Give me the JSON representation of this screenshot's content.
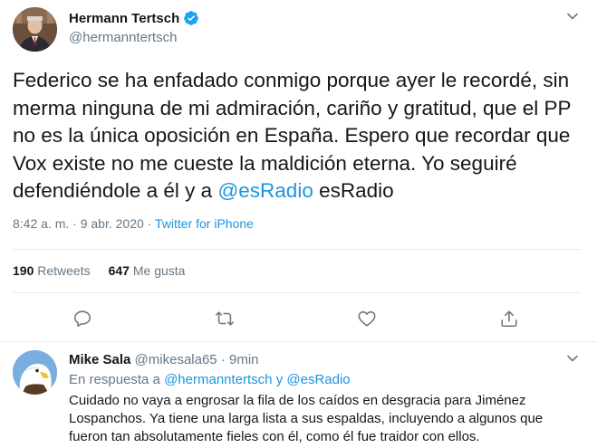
{
  "tweet": {
    "display_name": "Hermann Tertsch",
    "handle": "@hermanntertsch",
    "text_before_mention": "Federico se ha enfadado conmigo porque ayer le recordé, sin merma ninguna de mi admiración, cariño y gratitud, que el PP no es la única oposición en España. Espero que recordar que Vox existe no me cueste la maldición eterna. Yo seguiré defendiéndole a él y a ",
    "mention": "@esRadio",
    "text_after_mention": " esRadio",
    "time": "8:42 a. m.",
    "date": "9 abr. 2020",
    "separator": "·",
    "source": "Twitter for iPhone",
    "retweets_count": "190",
    "retweets_label": "Retweets",
    "likes_count": "647",
    "likes_label": "Me gusta",
    "actions": [
      "reply-icon",
      "retweet-icon",
      "like-icon",
      "share-icon"
    ]
  },
  "reply": {
    "display_name": "Mike Sala",
    "handle": "@mikesala65",
    "separator": "·",
    "time_ago": "9min",
    "replying_prefix": "En respuesta a ",
    "replying_mention_1": "@hermanntertsch",
    "replying_and": " y ",
    "replying_mention_2": "@esRadio",
    "text": "Cuidado no vaya a engrosar la fila de los caídos en desgracia para Jiménez Lospanchos. Ya tiene una larga lista a sus espaldas, incluyendo a algunos que fueron tan absolutamente fieles con él, como él fue traidor con ellos."
  },
  "colors": {
    "accent": "#1b95e0",
    "secondary_text": "#657786",
    "primary_text": "#14171a",
    "divider": "#e6ecf0"
  }
}
